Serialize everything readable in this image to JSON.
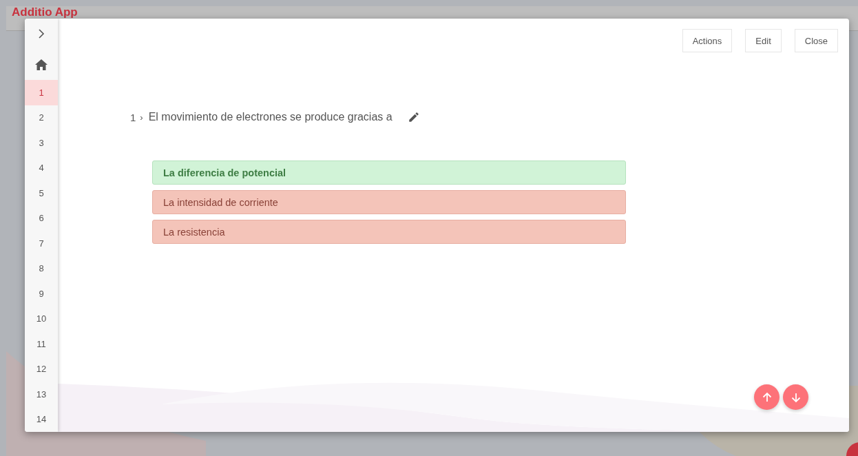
{
  "app_title": "Additio App",
  "sidebar": {
    "items": [
      {
        "label": "1",
        "selected": true
      },
      {
        "label": "2",
        "selected": false
      },
      {
        "label": "3",
        "selected": false
      },
      {
        "label": "4",
        "selected": false
      },
      {
        "label": "5",
        "selected": false
      },
      {
        "label": "6",
        "selected": false
      },
      {
        "label": "7",
        "selected": false
      },
      {
        "label": "8",
        "selected": false
      },
      {
        "label": "9",
        "selected": false
      },
      {
        "label": "10",
        "selected": false
      },
      {
        "label": "11",
        "selected": false
      },
      {
        "label": "12",
        "selected": false
      },
      {
        "label": "13",
        "selected": false
      },
      {
        "label": "14",
        "selected": false
      }
    ]
  },
  "toolbar": {
    "buttons": [
      "Actions",
      "Edit",
      "Close"
    ]
  },
  "question": {
    "number": "1",
    "separator": "›",
    "text": "El movimiento de electrones se produce gracias a"
  },
  "options": [
    {
      "text": "La diferencia de potencial",
      "kind": "correct"
    },
    {
      "text": "La intensidad de corriente",
      "kind": "incorrect"
    },
    {
      "text": "La resistencia",
      "kind": "incorrect"
    }
  ]
}
